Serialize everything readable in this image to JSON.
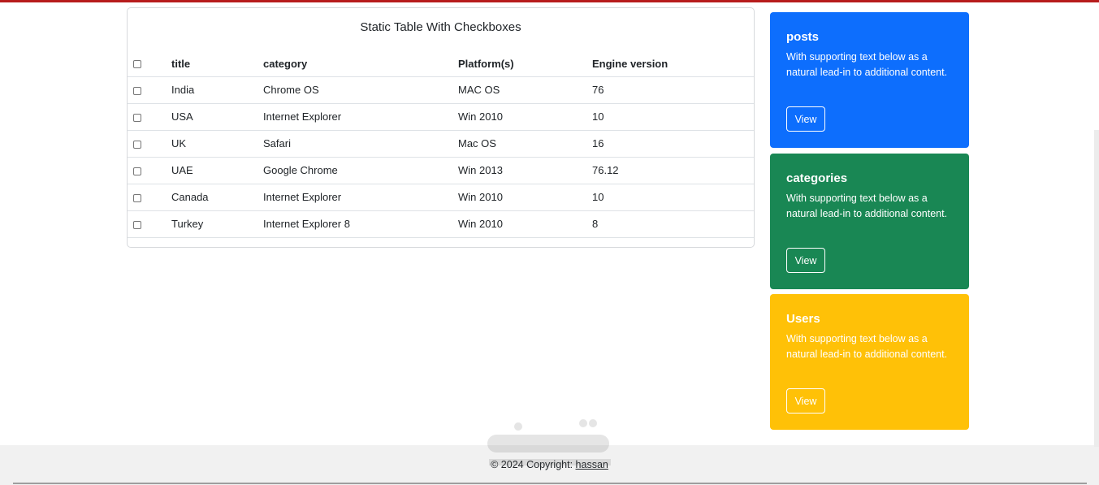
{
  "table": {
    "title": "Static Table With Checkboxes",
    "headers": [
      "title",
      "category",
      "Platform(s)",
      "Engine version"
    ],
    "rows": [
      [
        "India",
        "Chrome OS",
        "MAC OS",
        "76"
      ],
      [
        "USA",
        "Internet Explorer",
        "Win 2010",
        "10"
      ],
      [
        "UK",
        "Safari",
        "Mac OS",
        "16"
      ],
      [
        "UAE",
        "Google Chrome",
        "Win 2013",
        "76.12"
      ],
      [
        "Canada",
        "Internet Explorer",
        "Win 2010",
        "10"
      ],
      [
        "Turkey",
        "Internet Explorer 8",
        "Win 2010",
        "8"
      ]
    ]
  },
  "cards": [
    {
      "title": "posts",
      "text": "With supporting text below as a natural lead-in to additional content.",
      "button": "View",
      "color": "#0d6efd"
    },
    {
      "title": "categories",
      "text": "With supporting text below as a natural lead-in to additional content.",
      "button": "View",
      "color": "#198754"
    },
    {
      "title": "Users",
      "text": "With supporting text below as a natural lead-in to additional content.",
      "button": "View",
      "color": "#ffc107"
    }
  ],
  "footer": {
    "copyright": "© 2024 Copyright: ",
    "link": "hassan"
  },
  "colors": {
    "top_bar": "#b71c1c"
  }
}
